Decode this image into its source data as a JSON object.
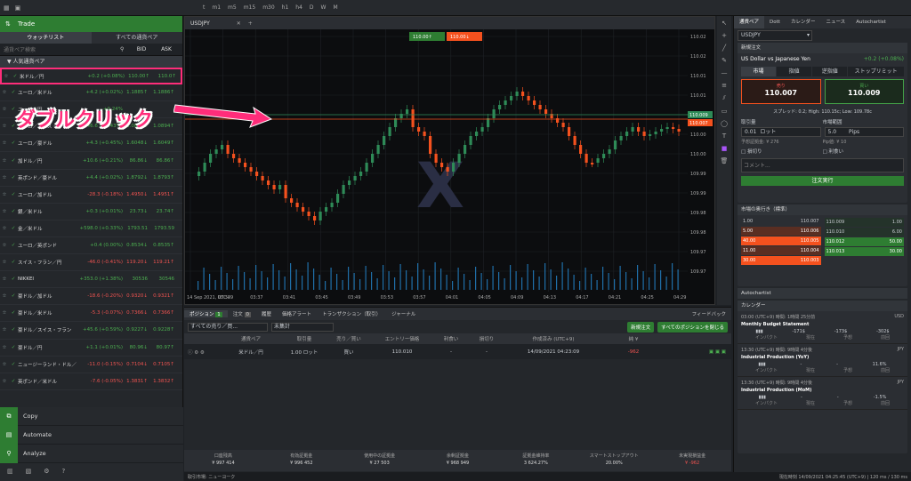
{
  "colors": {
    "up": "#4caf50",
    "down": "#ef5350",
    "accent": "#2e7d32",
    "bull_candle": "#2e8b57",
    "bear_candle": "#f4511e",
    "annotation": "#ff2d7a"
  },
  "topbar": {
    "icons": [
      "grid-icon",
      "layout-icon",
      "window-icon",
      "lock-icon",
      "fullscreen-icon"
    ],
    "timeframes": [
      "t",
      "m1",
      "m5",
      "m15",
      "m30",
      "h1",
      "h4",
      "D",
      "W",
      "M"
    ]
  },
  "left": {
    "trade_label": "Trade",
    "tabs": [
      "ウォッチリスト",
      "すべての通貨ペア"
    ],
    "search_placeholder": "通貨ペア検索",
    "bid_label": "BID",
    "ask_label": "ASK",
    "group": "▼ 人気通貨ペア",
    "rows": [
      {
        "name": "米ドル／円",
        "chg": "+0.2 (+0.08%)",
        "bid": "110.00↑",
        "ask": "110.0↑",
        "dir": "up",
        "selected": true
      },
      {
        "name": "ユーロ／米ドル",
        "chg": "+4.2 (+0.02%)",
        "bid": "1.1885↑",
        "ask": "1.1886↑",
        "dir": "up"
      },
      {
        "name": "ユーロ／円",
        "chg": "+0.24%",
        "bid": "",
        "ask": "",
        "dir": "up"
      },
      {
        "name": "ユーロ／スイス・フラン",
        "chg": "+46.6 (+0.43%)",
        "bid": "1.0893↓",
        "ask": "1.0894↑",
        "dir": "up"
      },
      {
        "name": "ユーロ／豪ドル",
        "chg": "+4.3 (+0.45%)",
        "bid": "1.6048↓",
        "ask": "1.6049↑",
        "dir": "up"
      },
      {
        "name": "加ドル／円",
        "chg": "+10.6 (+0.21%)",
        "bid": "86.86↓",
        "ask": "86.86↑",
        "dir": "up"
      },
      {
        "name": "英ポンド／豪ドル",
        "chg": "+4.4 (+0.02%)",
        "bid": "1.8792↓",
        "ask": "1.8793↑",
        "dir": "up"
      },
      {
        "name": "ユーロ／加ドル",
        "chg": "-28.3 (-0.18%)",
        "bid": "1.4950↓",
        "ask": "1.4951↑",
        "dir": "down"
      },
      {
        "name": "銀／米ドル",
        "chg": "+0.3 (+0.01%)",
        "bid": "23.73↓",
        "ask": "23.74↑",
        "dir": "up"
      },
      {
        "name": "金／米ドル",
        "chg": "+598.0 (+0.33%)",
        "bid": "1793.51",
        "ask": "1793.59",
        "dir": "up"
      },
      {
        "name": "ユーロ／英ポンド",
        "chg": "+0.4 (0.00%)",
        "bid": "0.8534↓",
        "ask": "0.8535↑",
        "dir": "up"
      },
      {
        "name": "スイス・フラン／円",
        "chg": "-46.0 (-0.41%)",
        "bid": "119.20↓",
        "ask": "119.21↑",
        "dir": "down"
      },
      {
        "name": "NIKKEI",
        "chg": "+353.0 (+1.38%)",
        "bid": "30536",
        "ask": "30546",
        "dir": "up"
      },
      {
        "name": "豪ドル／加ドル",
        "chg": "-18.6 (-0.20%)",
        "bid": "0.9320↓",
        "ask": "0.9321↑",
        "dir": "down"
      },
      {
        "name": "豪ドル／米ドル",
        "chg": "-5.3 (-0.07%)",
        "bid": "0.7366↓",
        "ask": "0.7366↑",
        "dir": "down"
      },
      {
        "name": "豪ドル／スイス・フラン",
        "chg": "+45.6 (+0.59%)",
        "bid": "0.9227↓",
        "ask": "0.9228↑",
        "dir": "up"
      },
      {
        "name": "豪ドル／円",
        "chg": "+1.1 (+0.01%)",
        "bid": "80.96↓",
        "ask": "80.97↑",
        "dir": "up"
      },
      {
        "name": "ニュージーランド・ドル／米ドル",
        "chg": "-11.0 (-0.15%)",
        "bid": "0.7104↓",
        "ask": "0.7105↑",
        "dir": "down"
      },
      {
        "name": "英ポンド／米ドル",
        "chg": "-7.6 (-0.05%)",
        "bid": "1.3831↑",
        "ask": "1.3832↑",
        "dir": "down"
      }
    ],
    "menu": [
      "Copy",
      "Automate",
      "Analyze"
    ]
  },
  "chart": {
    "tab": "USDJPY",
    "sell_price": "110.00↑",
    "buy_price": "110.00↓",
    "y_ticks": [
      "110.02",
      "110.02",
      "110.01",
      "110.01",
      "110.00",
      "110.00",
      "110.00",
      "109.99",
      "109.99",
      "109.98",
      "109.98",
      "109.97",
      "109.97"
    ],
    "price_tags": [
      "110.009",
      "110.007"
    ],
    "x_ticks": [
      "14 Sep 2021, UTC+9",
      "03:33",
      "03:37",
      "03:41",
      "03:45",
      "03:49",
      "03:53",
      "03:57",
      "04:01",
      "04:05",
      "04:09",
      "04:13",
      "04:17",
      "04:21",
      "04:25",
      "04:29"
    ]
  },
  "annotation": "ダブルクリック",
  "right": {
    "tabs": [
      "通貨ペア",
      "Dott",
      "カレンダー",
      "ニュース",
      "Autochartist"
    ],
    "symbol": "USDJPY",
    "new_order": "新規注文",
    "pair_title": "US Dollar vs Japanese Yen",
    "pair_chg": "+0.2 (+0.08%)",
    "order_types": [
      "市場",
      "指値",
      "逆指値",
      "ストップリミット"
    ],
    "sell_label": "売り",
    "sell_price": "110.007",
    "buy_label": "買い",
    "buy_price": "110.009",
    "spread": "スプレッド: 0.2; High: 110.15c; Low: 109.78c",
    "qty_label": "取引量",
    "qty_value": "0.01",
    "qty_unit": "ロット",
    "margin": "予想証拠金: ¥ 276",
    "range_label": "市場範囲",
    "range_value": "5.0",
    "range_unit": "Pips",
    "pip_value": "Pip値: ¥ 10",
    "sl": "損切り",
    "tp": "利食い",
    "comment_placeholder": "コメント...",
    "execute": "注文実行",
    "depth_title": "市場の奥行き（標準）",
    "depth_left": [
      [
        "1.00",
        "110.007"
      ],
      [
        "5.00",
        "110.006"
      ],
      [
        "40.00",
        "110.005"
      ],
      [
        "11.00",
        "110.004"
      ],
      [
        "30.00",
        "110.003"
      ]
    ],
    "depth_right": [
      [
        "110.009",
        "1.00"
      ],
      [
        "110.010",
        "6.00"
      ],
      [
        "110.012",
        "50.00"
      ],
      [
        "110.013",
        "30.00"
      ]
    ],
    "autochartist": "Autochartist",
    "calendar": "カレンダー",
    "events": [
      {
        "time": "03:00 (UTC+9) 時間: 1時間 25分前",
        "ccy": "USD",
        "title": "Monthly Budget Statement",
        "a": "-171$",
        "b": "-173$",
        "c": "-302$",
        "la": "インパクト",
        "lb": "現在",
        "lc": "予想",
        "ld": "前回"
      },
      {
        "time": "13:30 (UTC+9) 時間: 9時間 4分後",
        "ccy": "JPY",
        "title": "Industrial Production (YoY)",
        "a": "-",
        "b": "-",
        "c": "11.6%",
        "la": "インパクト",
        "lb": "現在",
        "lc": "予想",
        "ld": "前回"
      },
      {
        "time": "13:30 (UTC+9) 時間: 9時間 4分後",
        "ccy": "JPY",
        "title": "Industrial Production (MoM)",
        "a": "-",
        "b": "-",
        "c": "-1.5%",
        "la": "インパクト",
        "lb": "現在",
        "lc": "予想",
        "ld": "前回"
      }
    ]
  },
  "bottom": {
    "tabs": [
      "ポジション",
      "注文",
      "履歴",
      "価格アラート",
      "トランザクション（取引）",
      "ジャーナル"
    ],
    "pos_count": "1",
    "ord_count": "0",
    "feedback": "フィードバック",
    "filter1": "すべての売り／買...",
    "filter2": "未集計",
    "new_order": "新規注文",
    "close_all": "すべてのポジションを閉じる",
    "headers": [
      "通貨ペア",
      "取引量",
      "売り／買い",
      "エントリー価格",
      "利食い",
      "損切り",
      "作成済み (UTC+9)",
      "純 ¥"
    ],
    "position": [
      "米ドル／円",
      "1.00 ロット",
      "買い",
      "110.010",
      "-",
      "-",
      "14/09/2021 04:23:09",
      "-962"
    ]
  },
  "account": [
    [
      "口座残高",
      "¥ 997 414"
    ],
    [
      "有効証拠金",
      "¥ 996 452"
    ],
    [
      "使用中の証拠金",
      "¥ 27 503"
    ],
    [
      "余剰証拠金",
      "¥ 968 949"
    ],
    [
      "証拠金維持率",
      "3 624.27%"
    ],
    [
      "スマートストップアウト",
      "20.00%"
    ],
    [
      "未実現損益金",
      "¥ -962"
    ]
  ],
  "status": {
    "left": "取引市場: ニューヨーク",
    "right": "現在時刻 14/09/2021 04:25:45 (UTC+9) | 120 ms / 130 ms"
  }
}
